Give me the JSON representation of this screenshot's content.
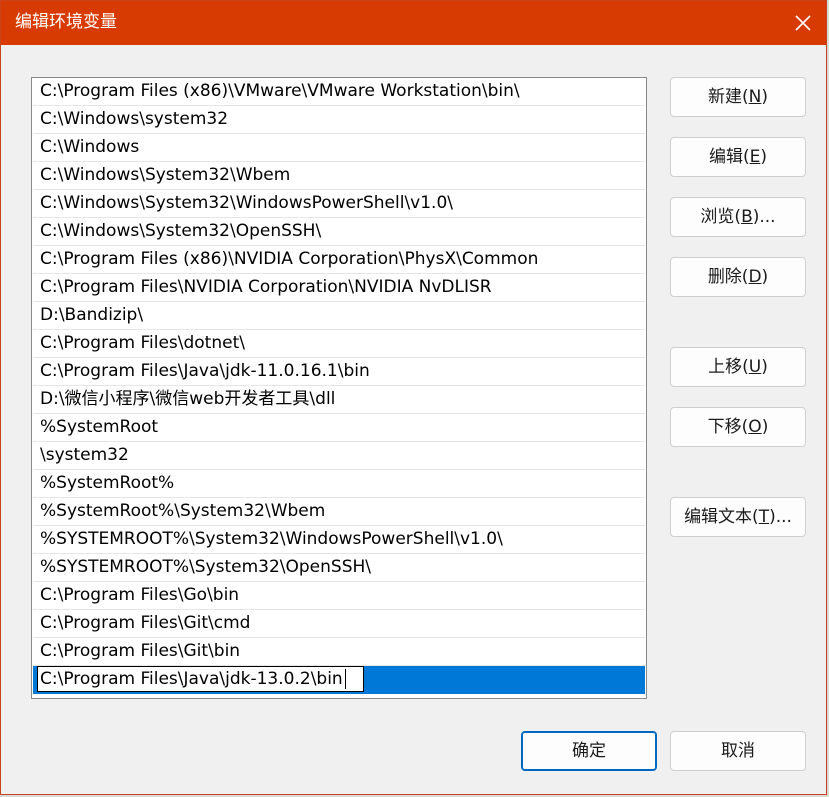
{
  "window": {
    "title": "编辑环境变量",
    "close_icon": "close-icon"
  },
  "paths": [
    "C:\\Program Files (x86)\\VMware\\VMware Workstation\\bin\\",
    "C:\\Windows\\system32",
    "C:\\Windows",
    "C:\\Windows\\System32\\Wbem",
    "C:\\Windows\\System32\\WindowsPowerShell\\v1.0\\",
    "C:\\Windows\\System32\\OpenSSH\\",
    "C:\\Program Files (x86)\\NVIDIA Corporation\\PhysX\\Common",
    "C:\\Program Files\\NVIDIA Corporation\\NVIDIA NvDLISR",
    "D:\\Bandizip\\",
    "C:\\Program Files\\dotnet\\",
    "C:\\Program Files\\Java\\jdk-11.0.16.1\\bin",
    "D:\\微信小程序\\微信web开发者工具\\dll",
    "%SystemRoot",
    "\\system32",
    "%SystemRoot%",
    "%SystemRoot%\\System32\\Wbem",
    "%SYSTEMROOT%\\System32\\WindowsPowerShell\\v1.0\\",
    "%SYSTEMROOT%\\System32\\OpenSSH\\",
    "C:\\Program Files\\Go\\bin",
    "C:\\Program Files\\Git\\cmd",
    "C:\\Program Files\\Git\\bin"
  ],
  "editing_value": "C:\\Program Files\\Java\\jdk-13.0.2\\bin",
  "buttons": {
    "new": {
      "text": "新建(",
      "key": "N",
      "suffix": ")"
    },
    "edit": {
      "text": "编辑(",
      "key": "E",
      "suffix": ")"
    },
    "browse": {
      "text": "浏览(",
      "key": "B",
      "suffix": ")..."
    },
    "delete": {
      "text": "删除(",
      "key": "D",
      "suffix": ")"
    },
    "move_up": {
      "text": "上移(",
      "key": "U",
      "suffix": ")"
    },
    "move_down": {
      "text": "下移(",
      "key": "O",
      "suffix": ")"
    },
    "edit_text": {
      "text": "编辑文本(",
      "key": "T",
      "suffix": ")..."
    },
    "ok": "确定",
    "cancel": "取消"
  },
  "colors": {
    "titlebar": "#d83b01",
    "selection": "#0078d7",
    "primary_border": "#0067c0"
  }
}
